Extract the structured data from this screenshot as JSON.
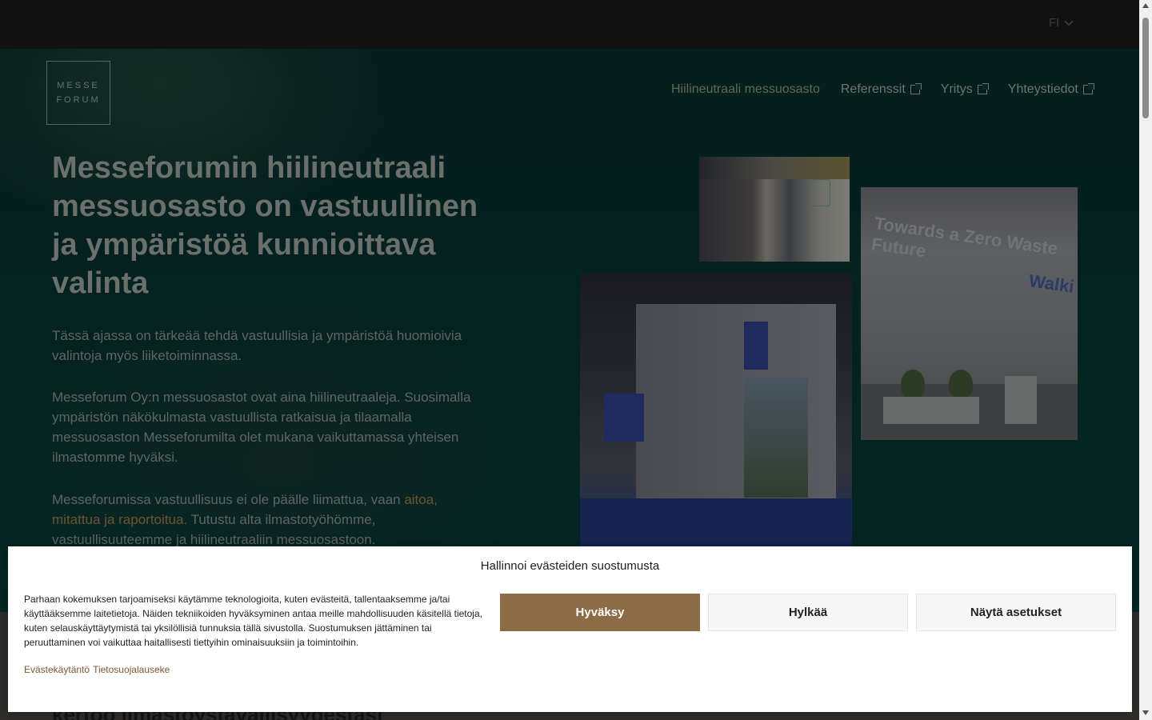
{
  "header": {
    "language": "FI"
  },
  "logo": {
    "line1": "MESSE",
    "line2": "FORUM"
  },
  "nav": {
    "items": [
      {
        "label": "Hiilineutraali messuosasto",
        "external": false
      },
      {
        "label": "Referenssit",
        "external": true
      },
      {
        "label": "Yritys",
        "external": true
      },
      {
        "label": "Yhteystiedot",
        "external": true
      }
    ]
  },
  "hero": {
    "title": "Messeforumin hiilineutraali messuosasto on vastuullinen ja ympäristöä kunnioittava valinta",
    "paragraph1": "Tässä ajassa on tärkeää tehdä vastuullisia ja ympäristöä huomioivia valintoja myös liiketoiminnassa.",
    "paragraph2": "Messeforum Oy:n messuosastot ovat aina hiilineutraaleja. Suosimalla ympäristön näkökulmasta vastuullista ratkaisua ja tilaamalla messuosaston Messeforumilta olet mukana vaikuttamassa yhteisen ilmastomme hyväksi.",
    "paragraph3_start": "Messeforumissa vastuullisuus ei ole päälle liimattua, vaan ",
    "paragraph3_accent": "aitoa, mitattua ja raportoitua.",
    "paragraph3_end": " Tutustu alta ilmastotyöhömme, vastuullisuuteemme ja hiilineutraaliin messuosastoon."
  },
  "photos": {
    "photo2_headline": "Towards a Zero Waste Future",
    "photo2_brand": "Walki"
  },
  "below": {
    "heading_fragment": "kertoo ilmastoystävällisyydestäsi"
  },
  "cookie": {
    "title": "Hallinnoi evästeiden suostumusta",
    "text": "Parhaan kokemuksen tarjoamiseksi käytämme teknologioita, kuten evästeitä, tallentaaksemme ja/tai käyttääksemme laitetietoja. Näiden tekniikoiden hyväksyminen antaa meille mahdollisuuden käsitellä tietoja, kuten selauskäyttäytymistä tai yksilöllisiä tunnuksia tällä sivustolla. Suostumuksen jättäminen tai peruuttaminen voi vaikuttaa haitallisesti tiettyihin ominaisuuksiin ja toimintoihin.",
    "link_cookie_policy": "Evästekäytäntö",
    "link_privacy": "Tietosuojalauseke",
    "accept_label": "Hyväksy",
    "reject_label": "Hylkää",
    "settings_label": "Näytä asetukset"
  },
  "colors": {
    "accent": "#8d6b44",
    "hero_bg": "#062a27",
    "topbar": "#111111"
  }
}
